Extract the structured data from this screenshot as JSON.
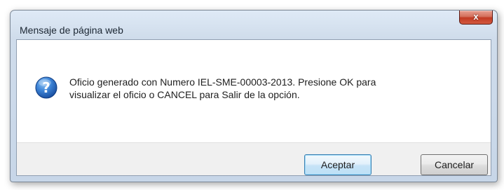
{
  "window": {
    "title": "Mensaje de página web",
    "close_symbol": "x"
  },
  "dialog": {
    "icon": "question-icon",
    "message_lines": [
      "Oficio generado con Numero IEL-SME-00003-2013. Presione OK para",
      "visualizar el oficio o CANCEL para Salir de la opción."
    ]
  },
  "buttons": {
    "accept_label": "Aceptar",
    "cancel_label": "Cancelar"
  },
  "colors": {
    "accent_border": "#3c7fb1",
    "close_button": "#c23a23",
    "icon_blue": "#1f5fb8"
  }
}
